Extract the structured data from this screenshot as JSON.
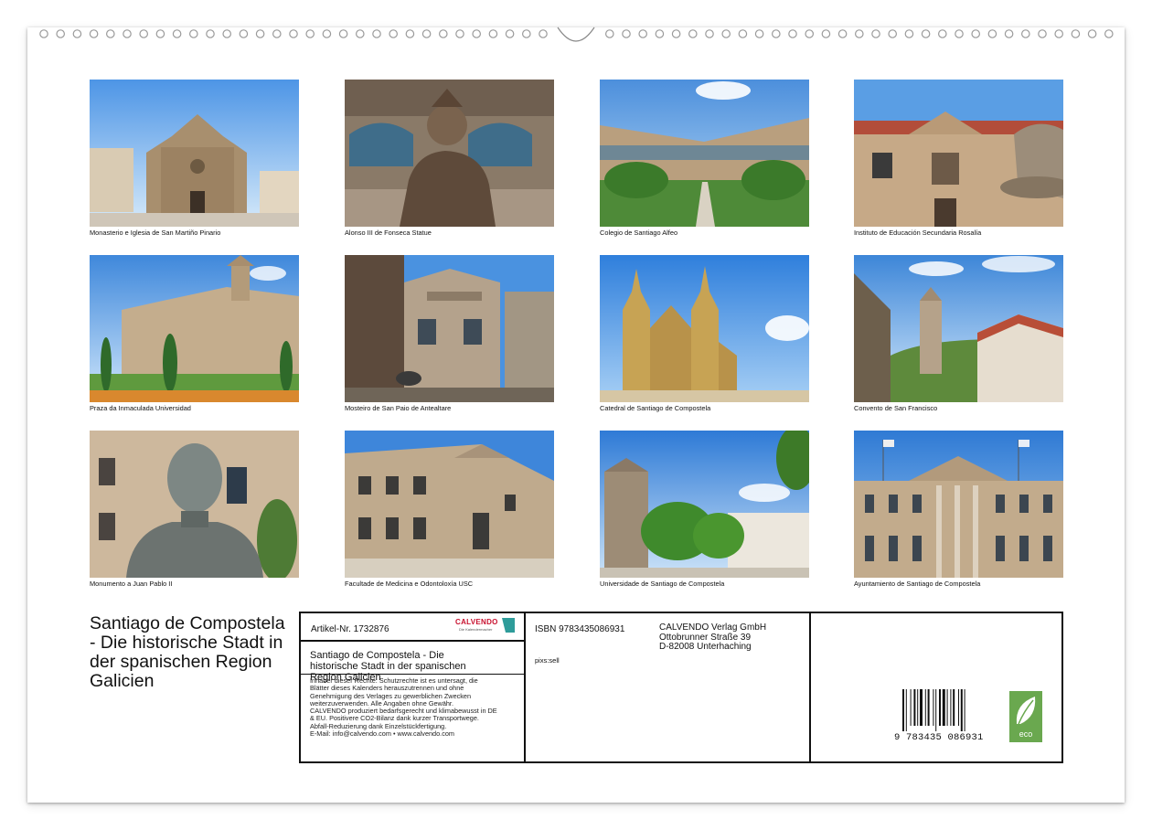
{
  "calendar": {
    "title": "Santiago de Compostela - Die historische Stadt in der spanischen Region Galicien"
  },
  "photos": [
    {
      "caption": "Monasterio e Iglesia de San Martiño Pinario"
    },
    {
      "caption": "Alonso III de Fonseca Statue"
    },
    {
      "caption": "Colegio de Santiago Alfeo"
    },
    {
      "caption": "Instituto de Educación Secundaria Rosalía"
    },
    {
      "caption": "Praza da Inmaculada Universidad"
    },
    {
      "caption": "Mosteiro de San Paio de Antealtare"
    },
    {
      "caption": "Catedral de Santiago de Compostela"
    },
    {
      "caption": "Convento de San Francisco"
    },
    {
      "caption": "Monumento a Juan Pablo II"
    },
    {
      "caption": "Facultade de Medicina e Odontoloxía USC"
    },
    {
      "caption": "Universidade de Santiago de Compostela"
    },
    {
      "caption": "Ayuntamiento de Santiago de Compostela"
    }
  ],
  "imprint": {
    "article_no": "Artikel-Nr. 1732876",
    "calvendo_logo": "CALVENDO",
    "calvendo_tagline": "Die Kalendermacher",
    "product_title": "Santiago de Compostela - Die historische Stadt in der spanischen Region Galicien",
    "legal_lines": [
      "Inhaber dieser Rechte: Schutzrechte ist es untersagt, die",
      "Blätter dieses Kalenders herauszutrennen und ohne",
      "Genehmigung des Verlages zu gewerblichen Zwecken",
      "weiterzuverwenden. Alle Angaben ohne Gewähr.",
      "CALVENDO produziert bedarfsgerecht und klimabewusst in DE",
      "& EU. Positivere CO2-Bilanz dank kurzer Transportwege.",
      "Abfall-Reduzierung dank Einzelstückfertigung.",
      "E-Mail: info@calvendo.com • www.calvendo.com"
    ],
    "isbn": "ISBN 9783435086931",
    "author": "pixs:sell",
    "publisher_lines": [
      "CALVENDO Verlag GmbH",
      "Ottobrunner Straße 39",
      "D-82008 Unterhaching"
    ],
    "barcode_digits": "9  783435  086931",
    "eco_label": "eco"
  }
}
